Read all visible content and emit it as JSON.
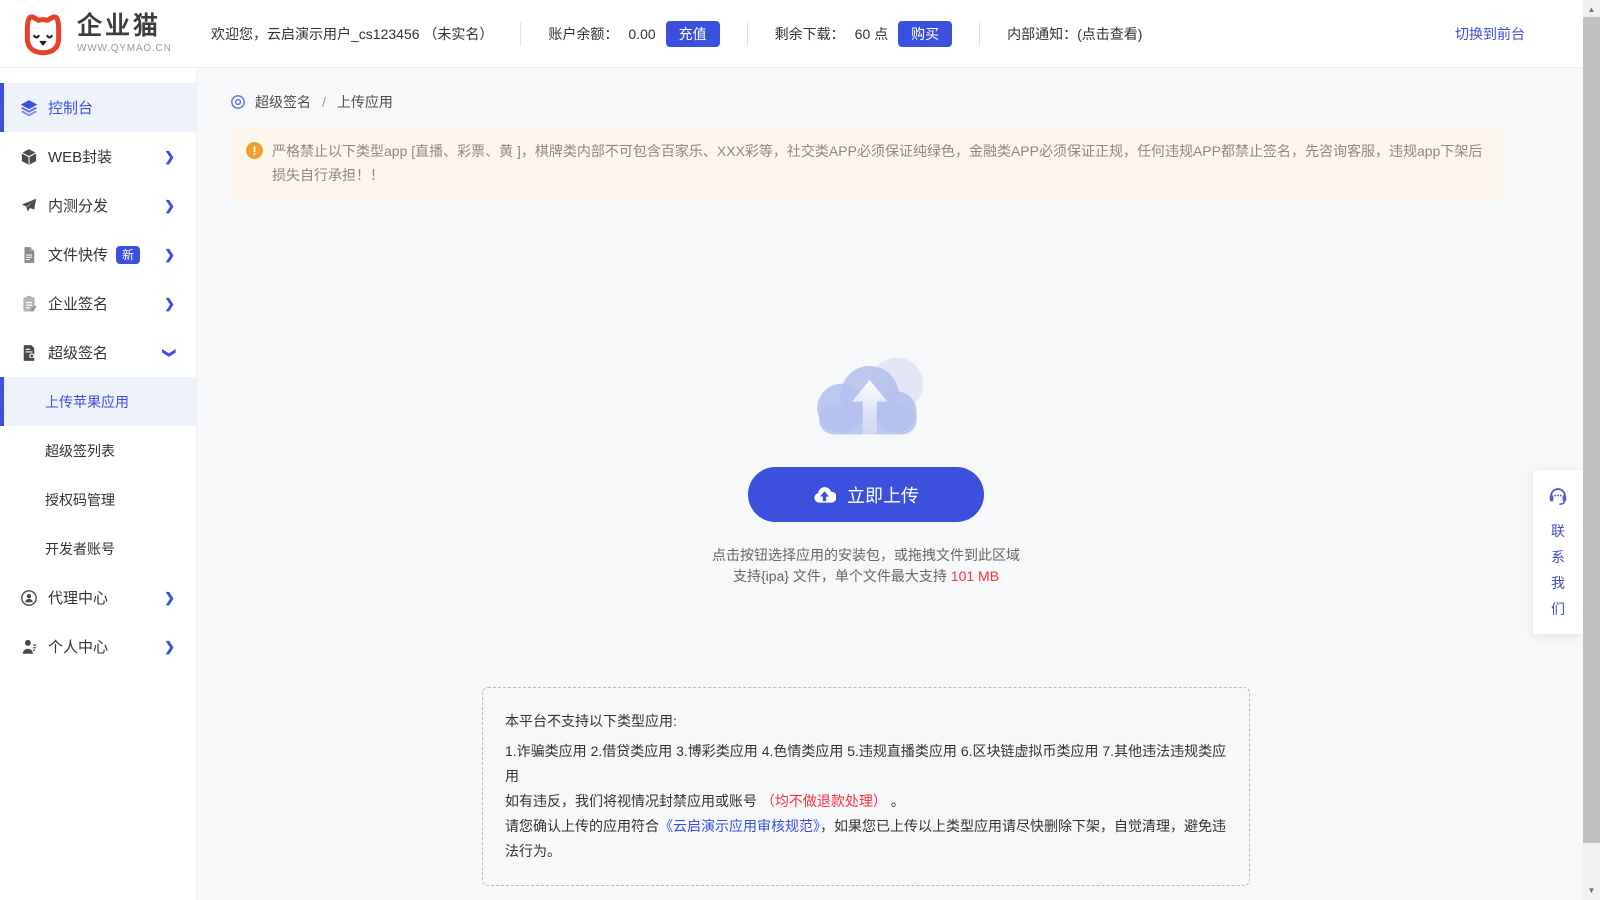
{
  "colors": {
    "accent": "#3b51dd",
    "accent_bg": "#edf2fb",
    "content_bg": "#f7f8fa",
    "warning_bg": "#fdf6ec",
    "warning_text": "#8f897d",
    "warning_icon": "#f0a033",
    "red": "#f5313d",
    "logo_red": "#e8402a"
  },
  "brand": {
    "name": "企业猫",
    "domain": "WWW.QYMAO.CN"
  },
  "header": {
    "welcome": "欢迎您，云启演示用户_cs123456 （未实名）",
    "balance_label": "账户余额：",
    "balance_value": "0.00",
    "recharge_button": "充值",
    "downloads_label": "剩余下载：",
    "downloads_value": "60 点",
    "buy_button": "购买",
    "notice": "内部通知：(点击查看)",
    "switch_link": "切换到前台"
  },
  "sidebar": {
    "items": [
      {
        "label": "控制台"
      },
      {
        "label": "WEB封装"
      },
      {
        "label": "内测分发"
      },
      {
        "label": "文件快传",
        "badge": "新"
      },
      {
        "label": "企业签名"
      },
      {
        "label": "超级签名"
      },
      {
        "label": "代理中心"
      },
      {
        "label": "个人中心"
      }
    ],
    "submenu": [
      {
        "label": "上传苹果应用"
      },
      {
        "label": "超级签列表"
      },
      {
        "label": "授权码管理"
      },
      {
        "label": "开发者账号"
      }
    ]
  },
  "breadcrumb": {
    "section": "超级签名",
    "separator": "/",
    "page": "上传应用"
  },
  "warning": {
    "text": "严格禁止以下类型app [直播、彩票、黄 ]，棋牌类内部不可包含百家乐、XXX彩等，社交类APP必须保证纯绿色，金融类APP必须保证正规，任何违规APP都禁止签名，先咨询客服，违规app下架后损失自行承担！！"
  },
  "upload": {
    "button": "立即上传",
    "hint_line1": "点击按钮选择应用的安装包，或拖拽文件到此区域",
    "hint_line2_prefix": "支持{ipa} 文件，单个文件最大支持 ",
    "max_size": "101 MB"
  },
  "rules": {
    "title": "本平台不支持以下类型应用:",
    "categories": "1.诈骗类应用 2.借贷类应用 3.博彩类应用 4.色情类应用 5.违规直播类应用 6.区块链虚拟币类应用 7.其他违法违规类应用",
    "violation_prefix": "如有违反，我们将视情况封禁应用或账号 ",
    "violation_red": "（均不做退款处理）",
    "violation_suffix": " 。",
    "confirm_prefix": "请您确认上传的应用符合",
    "confirm_link": "《云启演示应用审核规范》",
    "confirm_suffix": "，如果您已上传以上类型应用请尽快删除下架，自觉清理，避免违法行为。"
  },
  "contact": {
    "label": "联系我们"
  },
  "icons": {
    "exclamation": "!",
    "chevron": "❯",
    "scroll_up": "▲",
    "scroll_down": "▼"
  }
}
